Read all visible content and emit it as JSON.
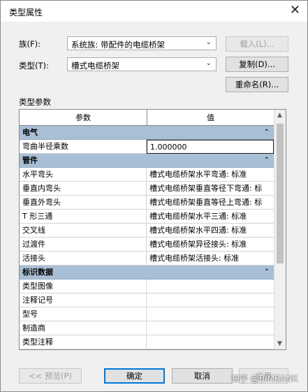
{
  "window": {
    "title": "类型属性",
    "close_glyph": "✕"
  },
  "family": {
    "label": "族(F):",
    "value": "系统族: 带配件的电缆桥架",
    "load_button": "载入(L)..."
  },
  "type": {
    "label": "类型(T):",
    "value": "槽式电缆桥架",
    "duplicate_button": "复制(D)...",
    "rename_button": "重命名(R)..."
  },
  "params": {
    "section_label": "类型参数",
    "col_param": "参数",
    "col_value": "值",
    "groups": [
      {
        "name": "电气",
        "rows": [
          {
            "k": "弯曲半径乘数",
            "v": "1.000000"
          }
        ]
      },
      {
        "name": "管件",
        "rows": [
          {
            "k": "水平弯头",
            "v": "槽式电缆桥架水平弯通: 标准"
          },
          {
            "k": "垂直内弯头",
            "v": "槽式电缆桥架垂直等径下弯通: 标"
          },
          {
            "k": "垂直外弯头",
            "v": "槽式电缆桥架垂直等径上弯通: 标"
          },
          {
            "k": "T 形三通",
            "v": "槽式电缆桥架水平三通: 标准"
          },
          {
            "k": "交叉线",
            "v": "槽式电缆桥架水平四通: 标准"
          },
          {
            "k": "过渡件",
            "v": "槽式电缆桥架异径接头: 标准"
          },
          {
            "k": "活接头",
            "v": "槽式电缆桥架活接头: 标准"
          }
        ]
      },
      {
        "name": "标识数据",
        "rows": [
          {
            "k": "类型图像",
            "v": ""
          },
          {
            "k": "注释记号",
            "v": ""
          },
          {
            "k": "型号",
            "v": ""
          },
          {
            "k": "制造商",
            "v": ""
          },
          {
            "k": "类型注释",
            "v": ""
          }
        ]
      }
    ],
    "collapse_glyph": "⌃"
  },
  "buttons": {
    "preview": "<< 预览(P)",
    "ok": "确定",
    "cancel": "取消",
    "apply": "应用"
  },
  "watermark": "知乎 @BIMBANK"
}
